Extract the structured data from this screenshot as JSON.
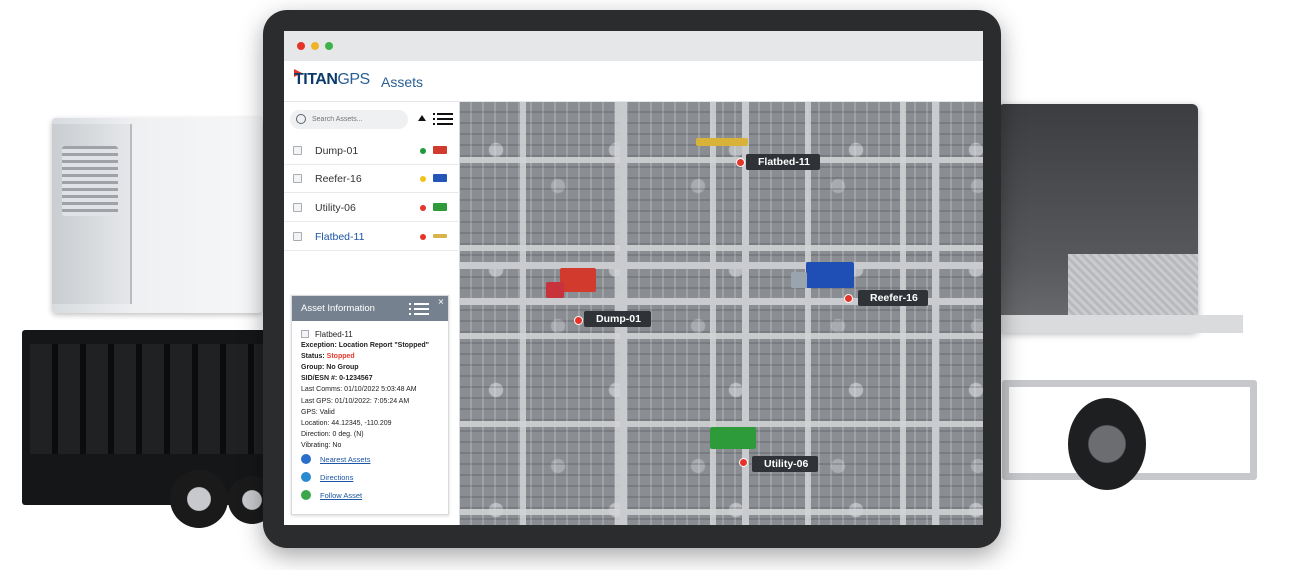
{
  "app": {
    "brand_main": "TITAN",
    "brand_suffix": "GPS",
    "title": "Assets",
    "window_controls": [
      "close-dot",
      "minimize-dot",
      "maximize-dot"
    ]
  },
  "colors": {
    "brand_blue": "#0b3a6a",
    "accent_blue": "#1c55a4",
    "status_red": "#e5332a",
    "status_green": "#1f9a3b",
    "status_yellow": "#f0c419",
    "panel_header": "#76818f"
  },
  "search": {
    "placeholder": "Search Assets..."
  },
  "toolbar": {
    "sort_icon": "sort-up-icon",
    "list_icon": "list-view-icon"
  },
  "assets": [
    {
      "name": "Dump-01",
      "status": "green",
      "icon": "dump-truck-icon"
    },
    {
      "name": "Reefer-16",
      "status": "yellow",
      "icon": "reefer-truck-icon"
    },
    {
      "name": "Utility-06",
      "status": "red",
      "icon": "utility-trailer-icon"
    },
    {
      "name": "Flatbed-11",
      "status": "red",
      "icon": "flatbed-trailer-icon",
      "selected": true
    }
  ],
  "info_panel": {
    "title": "Asset Information",
    "close": "×",
    "asset_name": "Flatbed-11",
    "exception": "Exception: Location Report \"Stopped\"",
    "status_label": "Status: ",
    "status_value": "Stopped",
    "group": "Group: No Group",
    "sid": "SID/ESN #: 0-1234567",
    "last_comms": "Last Comms: 01/10/2022 5:03:48 AM",
    "last_gps": "Last GPS: 01/10/2022: 7:05:24 AM",
    "gps": "GPS: Valid",
    "location": "Location: 44.12345, -110.209",
    "direction": "Direction: 0 deg. (N)",
    "vibrating": "Vibrating: No",
    "links": [
      "Nearest Assets",
      "Directions",
      "Follow Asset"
    ]
  },
  "map_markers": [
    {
      "name": "Flatbed-11"
    },
    {
      "name": "Reefer-16"
    },
    {
      "name": "Dump-01"
    },
    {
      "name": "Utility-06"
    }
  ]
}
